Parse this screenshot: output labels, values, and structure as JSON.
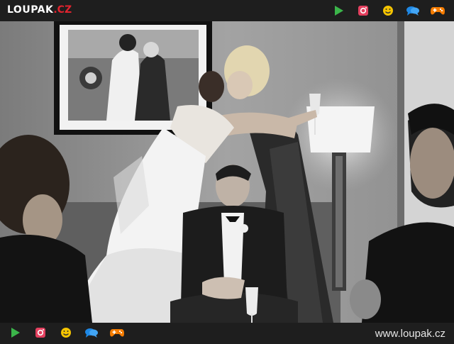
{
  "header": {
    "logo_main": "LOUPAK",
    "logo_tld": ".CZ",
    "icons": [
      "play-icon",
      "instagram-icon",
      "smiley-icon",
      "chat-icon",
      "gamepad-icon"
    ]
  },
  "colors": {
    "bar_bg": "#1e1e1e",
    "play": "#3bb54a",
    "instagram": "#e4405f",
    "smiley": "#f5c400",
    "chat": "#1e88e5",
    "gamepad": "#f57c00",
    "logo_accent": "#e0232e"
  },
  "footer": {
    "site_url": "www.loupak.cz"
  }
}
